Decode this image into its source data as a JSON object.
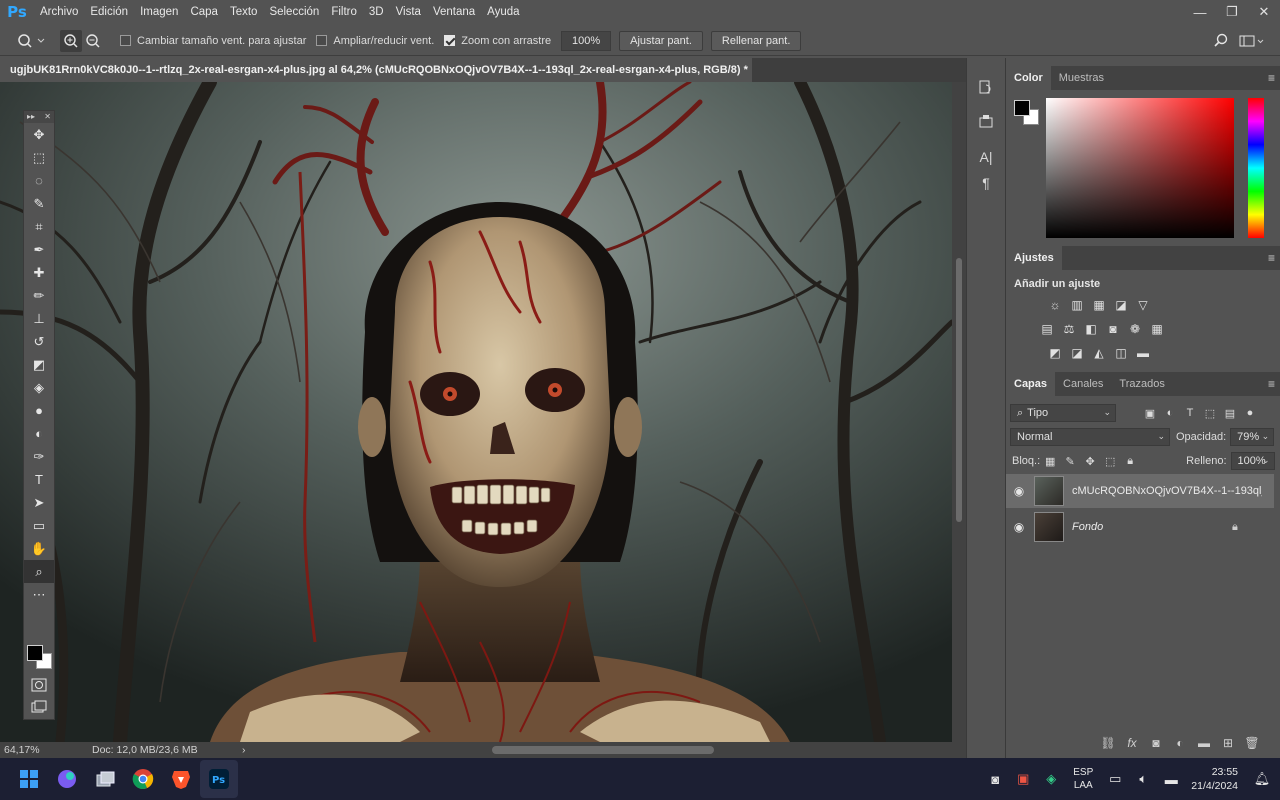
{
  "app": {
    "logo": "Ps",
    "menu": [
      "Archivo",
      "Edición",
      "Imagen",
      "Capa",
      "Texto",
      "Selección",
      "Filtro",
      "3D",
      "Vista",
      "Ventana",
      "Ayuda"
    ]
  },
  "window_controls": {
    "minimize": "—",
    "restore": "❐",
    "close": "✕"
  },
  "options_bar": {
    "resize_windows_label": "Cambiar tamaño vent. para ajustar",
    "resize_windows_checked": false,
    "zoom_all_label": "Ampliar/reducir vent.",
    "zoom_all_checked": false,
    "scrubby_zoom_label": "Zoom con arrastre",
    "scrubby_zoom_checked": true,
    "zoom_value": "100%",
    "fit_screen_label": "Ajustar pant.",
    "fill_screen_label": "Rellenar pant."
  },
  "document": {
    "tab_title": "ugjbUK81Rrn0kVC8k0J0--1--rtlzq_2x-real-esrgan-x4-plus.jpg al 64,2% (cMUcRQOBNxOQjvOV7B4X--1--193ql_2x-real-esrgan-x4-plus, RGB/8) *",
    "close": "×"
  },
  "status": {
    "zoom": "64,17%",
    "doc_size": "Doc: 12,0 MB/23,6 MB",
    "arrow": "›"
  },
  "tools": [
    {
      "name": "move-tool",
      "glyph": "✥"
    },
    {
      "name": "marquee-tool",
      "glyph": "⬚"
    },
    {
      "name": "lasso-tool",
      "glyph": "◌"
    },
    {
      "name": "quick-select-tool",
      "glyph": "✎"
    },
    {
      "name": "crop-tool",
      "glyph": "⌗"
    },
    {
      "name": "eyedropper-tool",
      "glyph": "✒"
    },
    {
      "name": "healing-brush-tool",
      "glyph": "✚"
    },
    {
      "name": "brush-tool",
      "glyph": "✏"
    },
    {
      "name": "clone-stamp-tool",
      "glyph": "⊥"
    },
    {
      "name": "history-brush-tool",
      "glyph": "↺"
    },
    {
      "name": "eraser-tool",
      "glyph": "◩"
    },
    {
      "name": "paint-bucket-tool",
      "glyph": "◈"
    },
    {
      "name": "blur-tool",
      "glyph": "●"
    },
    {
      "name": "dodge-tool",
      "glyph": "◐"
    },
    {
      "name": "pen-tool",
      "glyph": "✑"
    },
    {
      "name": "type-tool",
      "glyph": "T"
    },
    {
      "name": "path-select-tool",
      "glyph": "➤"
    },
    {
      "name": "rectangle-tool",
      "glyph": "▭"
    },
    {
      "name": "hand-tool",
      "glyph": "✋"
    },
    {
      "name": "zoom-tool",
      "glyph": "⌕"
    },
    {
      "name": "more-tools",
      "glyph": "⋯"
    }
  ],
  "panels": {
    "color_tabs": [
      "Color",
      "Muestras"
    ],
    "adjustments_tab": "Ajustes",
    "adjustments_title": "Añadir un ajuste",
    "layers_tabs": [
      "Capas",
      "Canales",
      "Trazados"
    ],
    "kind_filter": "Tipo",
    "blend_mode": "Normal",
    "opacity_label": "Opacidad:",
    "opacity_value": "79%",
    "lock_label": "Bloq.:",
    "fill_label": "Relleno:",
    "fill_value": "100%",
    "layers": [
      {
        "name": "cMUcRQOBNxOQjvOV7B4X--1--193ql_...",
        "selected": true,
        "italic": false
      },
      {
        "name": "Fondo",
        "selected": false,
        "italic": true
      }
    ]
  },
  "taskbar": {
    "lang_top": "ESP",
    "lang_bottom": "LAA",
    "time": "23:55",
    "date": "21/4/2024"
  }
}
